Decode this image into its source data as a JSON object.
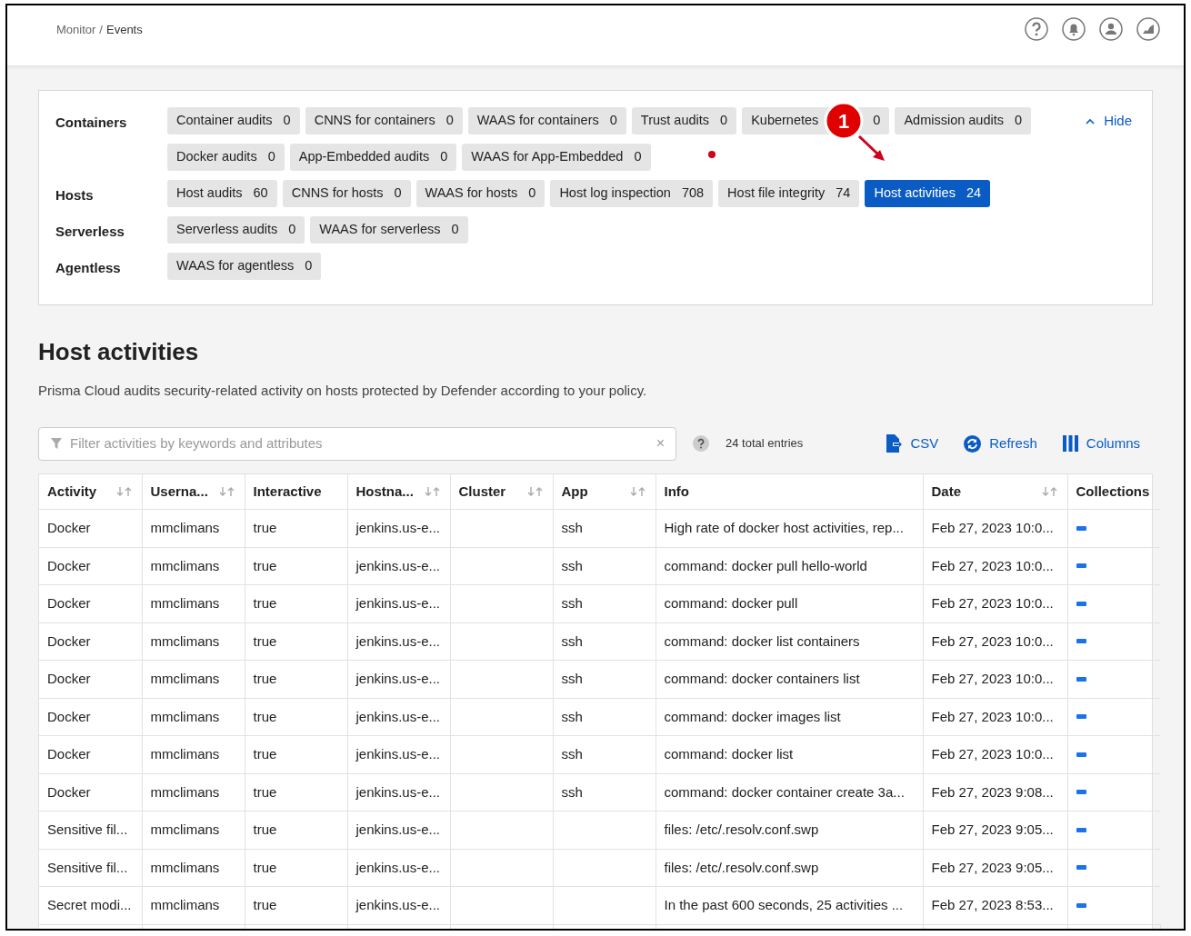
{
  "breadcrumb": {
    "parent": "Monitor",
    "separator": "/",
    "current": "Events"
  },
  "filters": {
    "hide_label": "Hide",
    "expanded": true,
    "groups": [
      {
        "label": "Containers",
        "chip_rows": [
          [
            {
              "label": "Container audits",
              "count": "0",
              "selected": false
            },
            {
              "label": "CNNS for containers",
              "count": "0",
              "selected": false
            },
            {
              "label": "WAAS for containers",
              "count": "0",
              "selected": false
            },
            {
              "label": "Trust audits",
              "count": "0",
              "selected": false
            },
            {
              "label": "Kubernetes",
              "count": "0",
              "selected": false,
              "covered": true
            },
            {
              "label": "Admission audits",
              "count": "0",
              "selected": false
            }
          ],
          [
            {
              "label": "Docker audits",
              "count": "0",
              "selected": false
            },
            {
              "label": "App-Embedded audits",
              "count": "0",
              "selected": false
            },
            {
              "label": "WAAS for App-Embedded",
              "count": "0",
              "selected": false
            }
          ]
        ]
      },
      {
        "label": "Hosts",
        "chip_rows": [
          [
            {
              "label": "Host audits",
              "count": "60",
              "selected": false
            },
            {
              "label": "CNNS for hosts",
              "count": "0",
              "selected": false
            },
            {
              "label": "WAAS for hosts",
              "count": "0",
              "selected": false
            },
            {
              "label": "Host log inspection",
              "count": "708",
              "selected": false
            },
            {
              "label": "Host file integrity",
              "count": "74",
              "selected": false
            },
            {
              "label": "Host activities",
              "count": "24",
              "selected": true
            }
          ]
        ]
      },
      {
        "label": "Serverless",
        "chip_rows": [
          [
            {
              "label": "Serverless audits",
              "count": "0",
              "selected": false
            },
            {
              "label": "WAAS for serverless",
              "count": "0",
              "selected": false
            }
          ]
        ]
      },
      {
        "label": "Agentless",
        "chip_rows": [
          [
            {
              "label": "WAAS for agentless",
              "count": "0",
              "selected": false
            }
          ]
        ]
      }
    ]
  },
  "annotation": {
    "label": "1"
  },
  "title": "Host activities",
  "description": "Prisma Cloud audits security-related activity on hosts protected by Defender according to your policy.",
  "toolbar": {
    "filter_placeholder": "Filter activities by keywords and attributes",
    "total": "24 total entries",
    "clear": "×",
    "actions": [
      {
        "kind": "csv",
        "label": "CSV"
      },
      {
        "kind": "refresh",
        "label": "Refresh"
      },
      {
        "kind": "columns",
        "label": "Columns"
      }
    ]
  },
  "table": {
    "columns": [
      {
        "label": "Activity",
        "sortable": true
      },
      {
        "label": "Userna...",
        "sortable": true
      },
      {
        "label": "Interactive",
        "sortable": false
      },
      {
        "label": "Hostna...",
        "sortable": true
      },
      {
        "label": "Cluster",
        "sortable": true
      },
      {
        "label": "App",
        "sortable": true
      },
      {
        "label": "Info",
        "sortable": false
      },
      {
        "label": "Date",
        "sortable": true
      },
      {
        "label": "Collections",
        "sortable": false
      }
    ],
    "rows": [
      [
        "Docker",
        "mmclimans",
        "true",
        "jenkins.us-e...",
        "",
        "ssh",
        "High rate of docker host activities, rep...",
        "Feb 27, 2023 10:0..."
      ],
      [
        "Docker",
        "mmclimans",
        "true",
        "jenkins.us-e...",
        "",
        "ssh",
        "command: docker pull hello-world",
        "Feb 27, 2023 10:0..."
      ],
      [
        "Docker",
        "mmclimans",
        "true",
        "jenkins.us-e...",
        "",
        "ssh",
        "command: docker pull",
        "Feb 27, 2023 10:0..."
      ],
      [
        "Docker",
        "mmclimans",
        "true",
        "jenkins.us-e...",
        "",
        "ssh",
        "command: docker list containers",
        "Feb 27, 2023 10:0..."
      ],
      [
        "Docker",
        "mmclimans",
        "true",
        "jenkins.us-e...",
        "",
        "ssh",
        "command: docker containers list",
        "Feb 27, 2023 10:0..."
      ],
      [
        "Docker",
        "mmclimans",
        "true",
        "jenkins.us-e...",
        "",
        "ssh",
        "command: docker images list",
        "Feb 27, 2023 10:0..."
      ],
      [
        "Docker",
        "mmclimans",
        "true",
        "jenkins.us-e...",
        "",
        "ssh",
        "command: docker list",
        "Feb 27, 2023 10:0..."
      ],
      [
        "Docker",
        "mmclimans",
        "true",
        "jenkins.us-e...",
        "",
        "ssh",
        "command: docker container create 3a...",
        "Feb 27, 2023 9:08..."
      ],
      [
        "Sensitive fil...",
        "mmclimans",
        "true",
        "jenkins.us-e...",
        "",
        "",
        "files: /etc/.resolv.conf.swp",
        "Feb 27, 2023 9:05..."
      ],
      [
        "Sensitive fil...",
        "mmclimans",
        "true",
        "jenkins.us-e...",
        "",
        "",
        "files: /etc/.resolv.conf.swp",
        "Feb 27, 2023 9:05..."
      ],
      [
        "Secret modi...",
        "mmclimans",
        "true",
        "jenkins.us-e...",
        "",
        "",
        "In the past 600 seconds, 25 activities ...",
        "Feb 27, 2023 8:53..."
      ]
    ]
  }
}
